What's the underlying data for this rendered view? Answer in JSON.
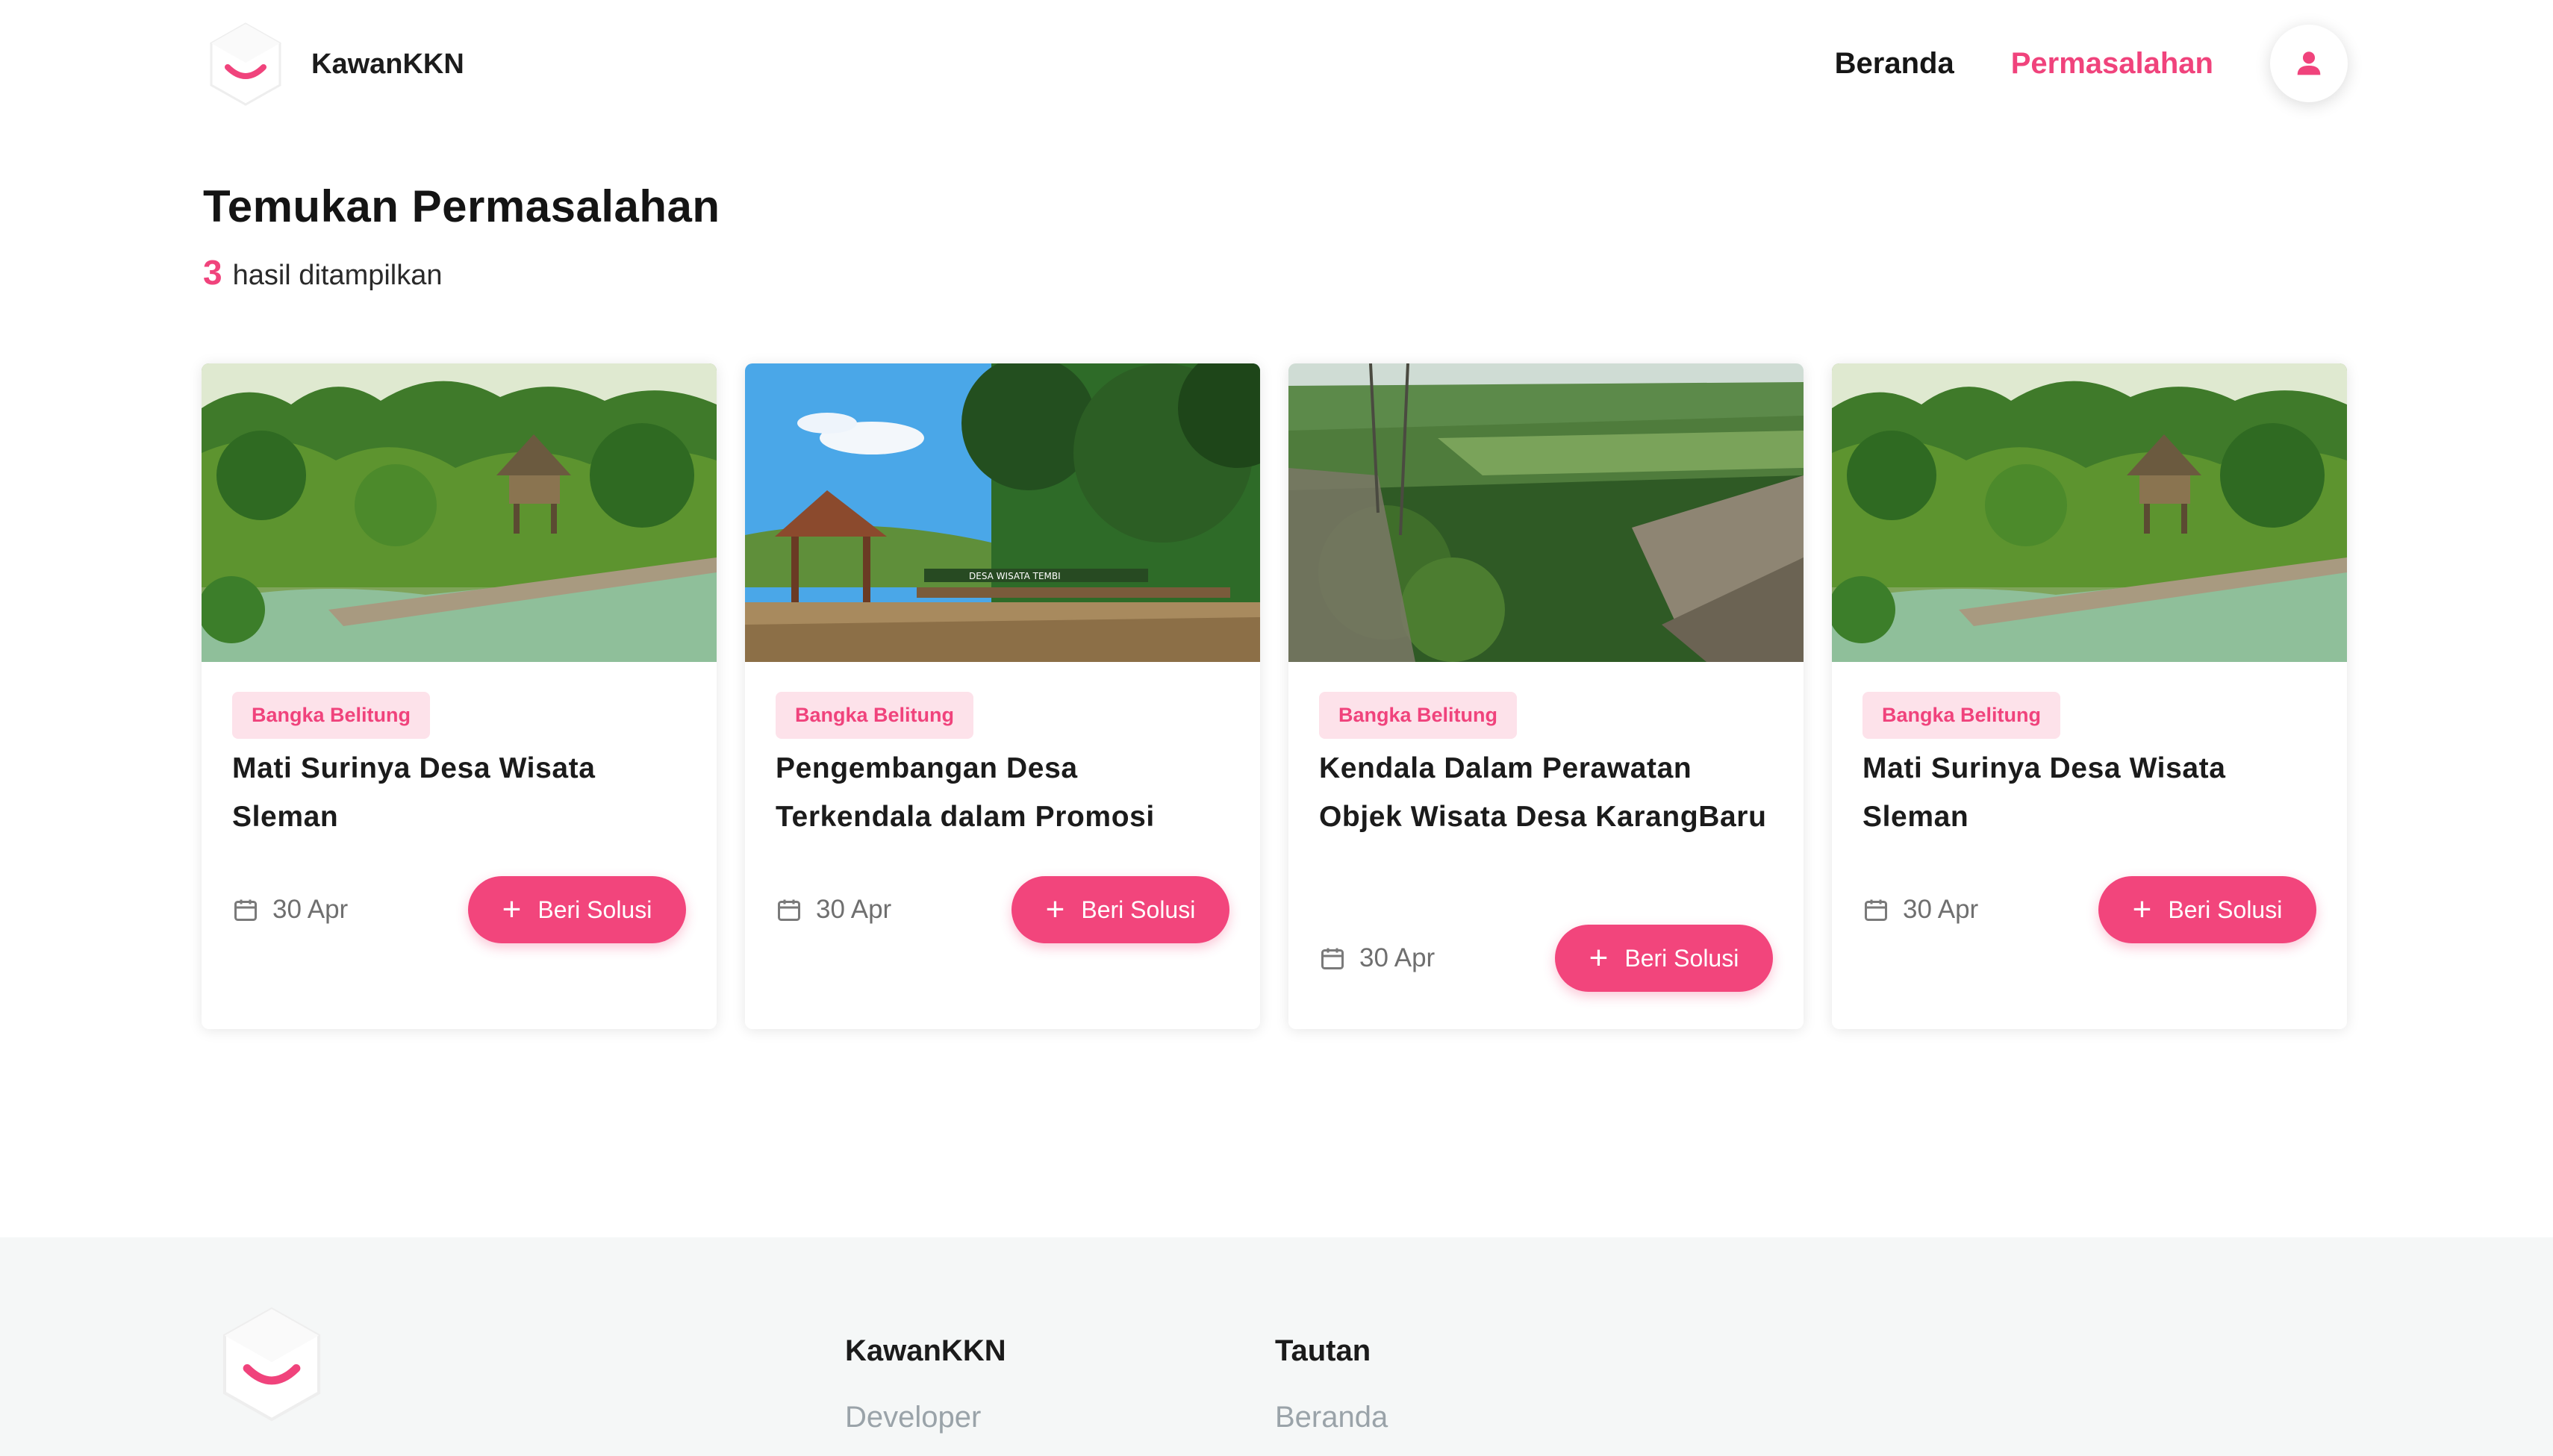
{
  "brand": {
    "name": "KawanKKN"
  },
  "nav": {
    "items": [
      {
        "label": "Beranda",
        "active": false
      },
      {
        "label": "Permasalahan",
        "active": true
      }
    ],
    "profile_icon": "user-icon"
  },
  "header": {
    "title": "Temukan Permasalahan",
    "result_count": "3",
    "result_text": "hasil ditampilkan"
  },
  "cards": [
    {
      "tag": "Bangka Belitung",
      "title": "Mati Surinya Desa Wisata Sleman",
      "date": "30 Apr",
      "button": "Beri Solusi",
      "image": "jungle-hut-pond"
    },
    {
      "tag": "Bangka Belitung",
      "title": "Pengembangan Desa Terkendala dalam Promosi",
      "date": "30 Apr",
      "button": "Beri Solusi",
      "image": "gazebo-desa-wisata"
    },
    {
      "tag": "Bangka Belitung",
      "title": "Kendala Dalam Perawatan Objek Wisata Desa KarangBaru",
      "date": "30 Apr",
      "button": "Beri Solusi",
      "image": "viewpoint-bridge"
    },
    {
      "tag": "Bangka Belitung",
      "title": "Mati Surinya Desa Wisata Sleman",
      "date": "30 Apr",
      "button": "Beri Solusi",
      "image": "jungle-hut-pond"
    }
  ],
  "footer": {
    "columns": [
      {
        "title": "KawanKKN",
        "items": [
          "Developer"
        ]
      },
      {
        "title": "Tautan",
        "items": [
          "Beranda"
        ]
      }
    ]
  },
  "colors": {
    "accent": "#f0437c",
    "tag_bg": "#fde2ea",
    "footer_bg": "#f5f7f7"
  }
}
